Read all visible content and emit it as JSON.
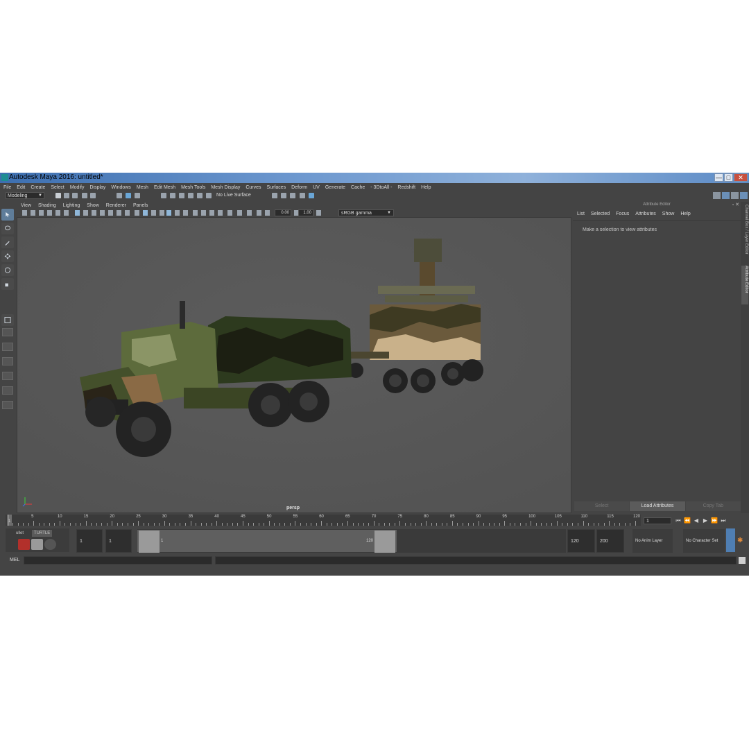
{
  "window": {
    "title": "Autodesk Maya 2016: untitled*",
    "controls": [
      "—",
      "□",
      "✕"
    ]
  },
  "menubar": {
    "items": [
      "File",
      "Edit",
      "Create",
      "Select",
      "Modify",
      "Display",
      "Windows",
      "Mesh",
      "Edit Mesh",
      "Mesh Tools",
      "Mesh Display",
      "Curves",
      "Surfaces",
      "Deform",
      "UV",
      "Generate",
      "Cache",
      "- 3DtoAll -",
      "Redshift",
      "Help"
    ]
  },
  "statusline": {
    "mode": "Modeling",
    "live_surface": "No Live Surface"
  },
  "viewport": {
    "menu": [
      "View",
      "Shading",
      "Lighting",
      "Show",
      "Renderer",
      "Panels"
    ],
    "exposure": "0.00",
    "gamma_value": "1.00",
    "color_space": "sRGB gamma",
    "camera_label": "persp"
  },
  "attribute_editor": {
    "title": "Attribute Editor",
    "menu": [
      "List",
      "Selected",
      "Focus",
      "Attributes",
      "Show",
      "Help"
    ],
    "message": "Make a selection to view attributes",
    "buttons": [
      "Select",
      "Load Attributes",
      "Copy Tab"
    ],
    "side_tabs": [
      "Channel Box / Layer Editor",
      "Attribute Editor"
    ]
  },
  "timeline": {
    "ticks": [
      "5",
      "10",
      "15",
      "20",
      "25",
      "30",
      "35",
      "40",
      "45",
      "50",
      "55",
      "60",
      "65",
      "70",
      "75",
      "80",
      "85",
      "90",
      "95",
      "100",
      "105",
      "110",
      "115",
      "120"
    ],
    "start_label": "1",
    "current_frame": "1",
    "playback_buttons": [
      "⏮",
      "⏪",
      "◀",
      "▶",
      "⏩",
      "⏭"
    ]
  },
  "range": {
    "shelf_tabs": [
      "ullet",
      "TURTLE"
    ],
    "start_frame": "1",
    "playback_start": "1",
    "range_start_label": "1",
    "range_end_label": "120",
    "playback_end": "120",
    "end_frame": "200",
    "anim_layer": "No Anim Layer",
    "character_set": "No Character Set"
  },
  "commandline": {
    "label": "MEL"
  }
}
